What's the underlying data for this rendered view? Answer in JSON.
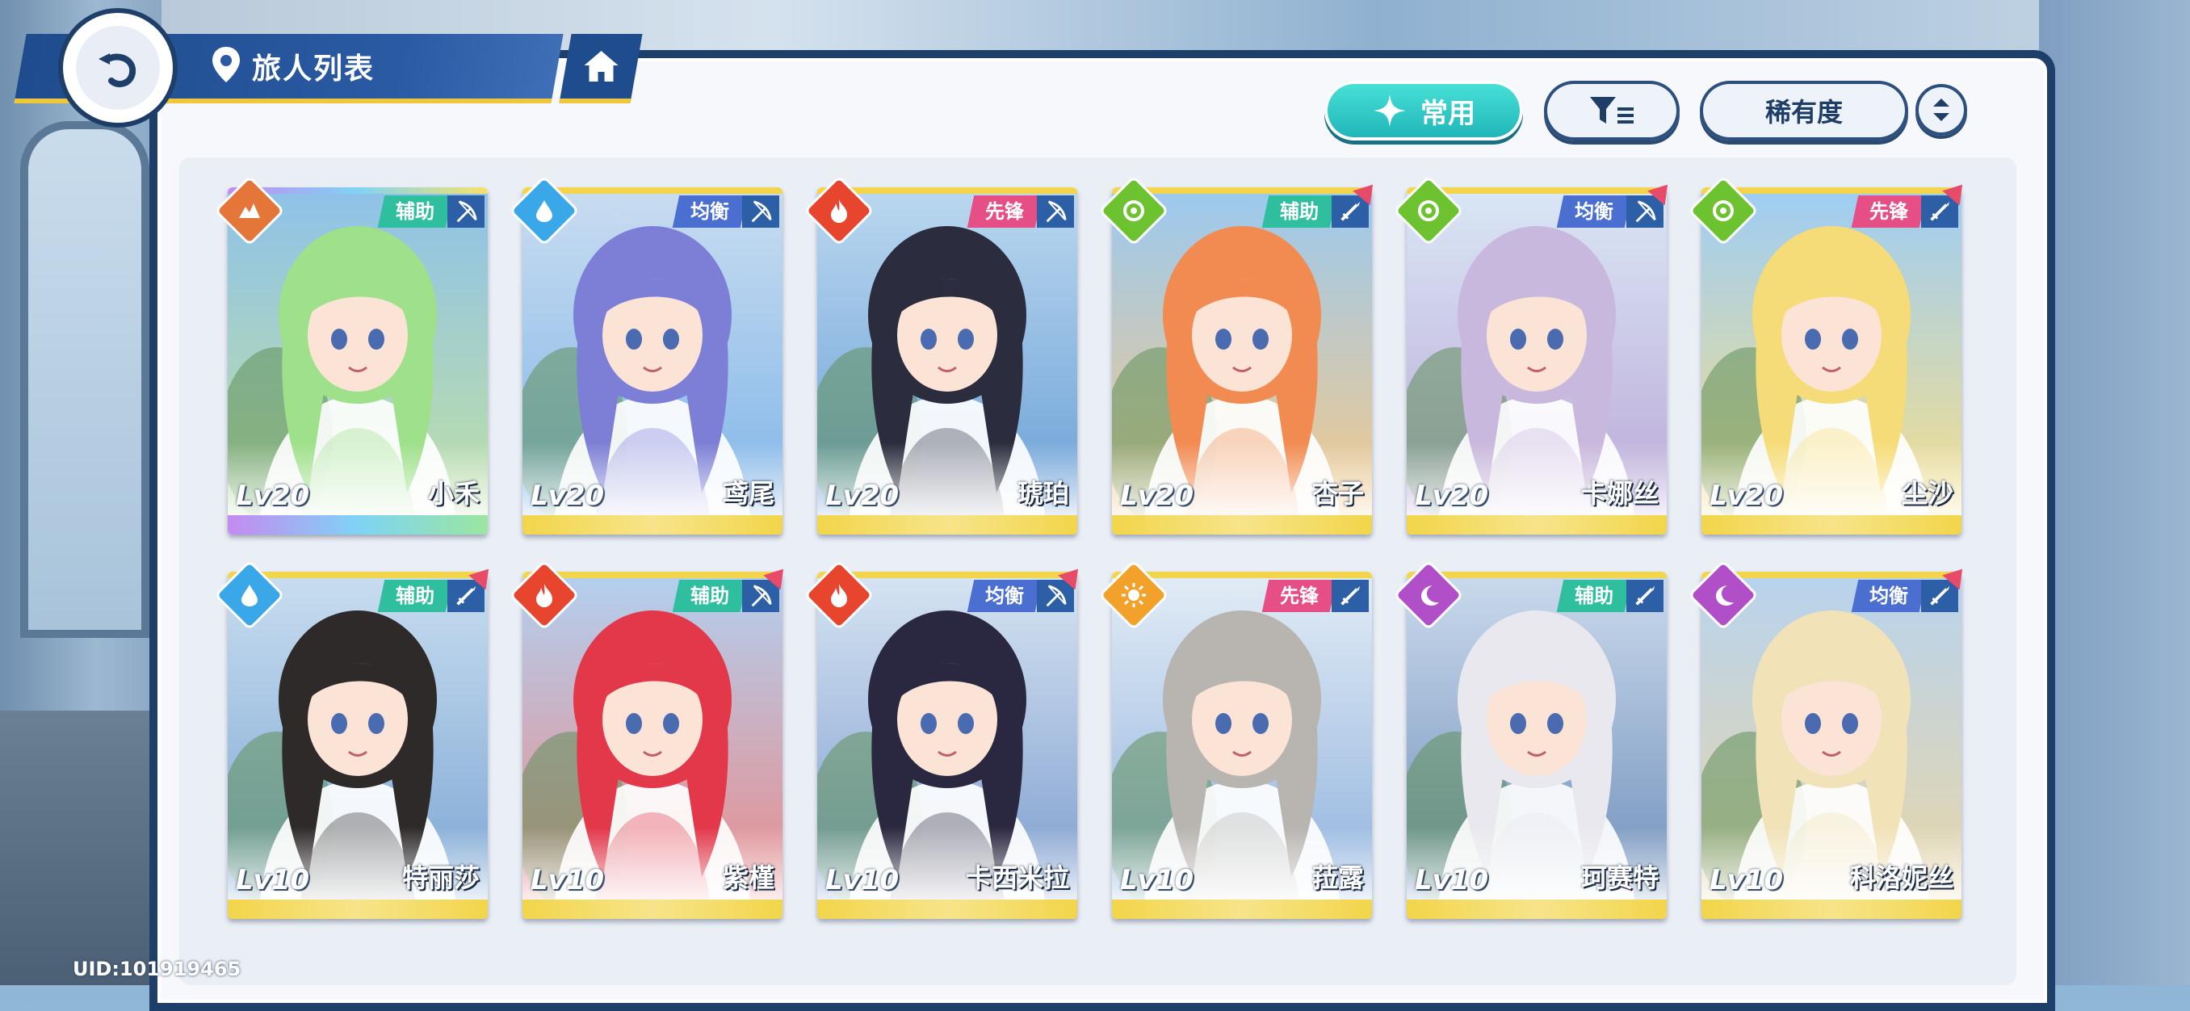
{
  "header": {
    "title": "旅人列表"
  },
  "toolbar": {
    "common_label": "常用",
    "sort_label": "稀有度"
  },
  "footer": {
    "uid": "UID:101919465"
  },
  "colors": {
    "accent_teal": "#1fb3b7",
    "navy": "#1e3f6a",
    "role_support": "#2fbf9f",
    "role_balance": "#4a6fd0",
    "role_vanguard": "#e64f86",
    "level_bar_gold": "#f2d54a",
    "level_bar_rainbow": "rainbow"
  },
  "characters": [
    {
      "name": "小禾",
      "level": "Lv20",
      "role": "辅助",
      "element": "earth-icon",
      "weapon": "bow-icon",
      "new": false
    },
    {
      "name": "鸢尾",
      "level": "Lv20",
      "role": "均衡",
      "element": "water-icon",
      "weapon": "bow-icon",
      "new": false
    },
    {
      "name": "琥珀",
      "level": "Lv20",
      "role": "先锋",
      "element": "fire-icon",
      "weapon": "bow-icon",
      "new": false
    },
    {
      "name": "杏子",
      "level": "Lv20",
      "role": "辅助",
      "element": "wind-icon",
      "weapon": "sword-icon",
      "new": true
    },
    {
      "name": "卡娜丝",
      "level": "Lv20",
      "role": "均衡",
      "element": "wind-icon",
      "weapon": "bow-icon",
      "new": true
    },
    {
      "name": "尘沙",
      "level": "Lv20",
      "role": "先锋",
      "element": "wind-icon",
      "weapon": "sword-icon",
      "new": true
    },
    {
      "name": "特丽莎",
      "level": "Lv10",
      "role": "辅助",
      "element": "water-icon",
      "weapon": "sword-icon",
      "new": true
    },
    {
      "name": "紫槿",
      "level": "Lv10",
      "role": "辅助",
      "element": "fire-icon",
      "weapon": "bow-icon",
      "new": true
    },
    {
      "name": "卡西米拉",
      "level": "Lv10",
      "role": "均衡",
      "element": "fire-icon",
      "weapon": "bow-icon",
      "new": true
    },
    {
      "name": "菈露",
      "level": "Lv10",
      "role": "先锋",
      "element": "sun-icon",
      "weapon": "sword-icon",
      "new": false
    },
    {
      "name": "珂赛特",
      "level": "Lv10",
      "role": "辅助",
      "element": "moon-icon",
      "weapon": "sword-icon",
      "new": false
    },
    {
      "name": "科洛妮丝",
      "level": "Lv10",
      "role": "均衡",
      "element": "moon-icon",
      "weapon": "sword-icon",
      "new": true
    }
  ]
}
